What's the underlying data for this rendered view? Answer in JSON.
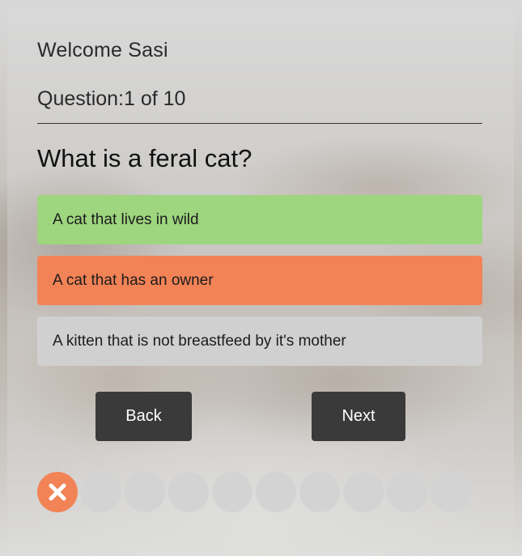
{
  "user": {
    "welcome": "Welcome Sasi"
  },
  "progress": {
    "label": "Question:1 of 10",
    "current": 1,
    "total": 10
  },
  "question": {
    "text": "What is a feral cat?",
    "answers": [
      {
        "text": "A cat that lives in wild",
        "state": "correct",
        "color": "#9ed57f"
      },
      {
        "text": "A cat that has an owner",
        "state": "selected-wrong",
        "color": "#f28356"
      },
      {
        "text": "A kitten that is not breastfeed by it's mother",
        "state": "neutral",
        "color": "#d0d0d0"
      }
    ]
  },
  "nav": {
    "back_label": "Back",
    "next_label": "Next"
  },
  "tracker": {
    "statuses": [
      "wrong",
      "pending",
      "pending",
      "pending",
      "pending",
      "pending",
      "pending",
      "pending",
      "pending",
      "pending"
    ],
    "wrong_icon": "close-icon"
  }
}
